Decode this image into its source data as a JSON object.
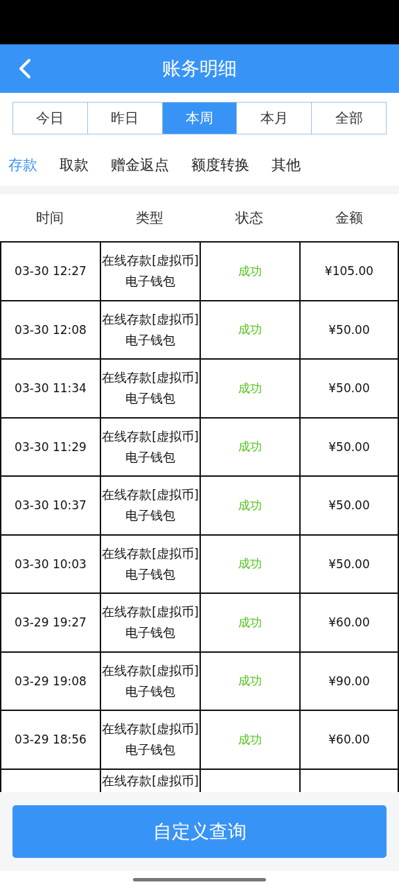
{
  "header": {
    "title": "账务明细"
  },
  "periods": [
    {
      "label": "今日",
      "selected": false
    },
    {
      "label": "昨日",
      "selected": false
    },
    {
      "label": "本周",
      "selected": true
    },
    {
      "label": "本月",
      "selected": false
    },
    {
      "label": "全部",
      "selected": false
    }
  ],
  "categories": [
    {
      "label": "存款",
      "selected": true
    },
    {
      "label": "取款",
      "selected": false
    },
    {
      "label": "赠金返点",
      "selected": false
    },
    {
      "label": "额度转换",
      "selected": false
    },
    {
      "label": "其他",
      "selected": false
    }
  ],
  "table": {
    "columns": [
      "时间",
      "类型",
      "状态",
      "金额"
    ],
    "rows": [
      {
        "time": "03-30 12:27",
        "type": [
          "在线存款[虚拟币]",
          "电子钱包"
        ],
        "status": "成功",
        "amount": "¥105.00"
      },
      {
        "time": "03-30 12:08",
        "type": [
          "在线存款[虚拟币]",
          "电子钱包"
        ],
        "status": "成功",
        "amount": "¥50.00"
      },
      {
        "time": "03-30 11:34",
        "type": [
          "在线存款[虚拟币]",
          "电子钱包"
        ],
        "status": "成功",
        "amount": "¥50.00"
      },
      {
        "time": "03-30 11:29",
        "type": [
          "在线存款[虚拟币]",
          "电子钱包"
        ],
        "status": "成功",
        "amount": "¥50.00"
      },
      {
        "time": "03-30 10:37",
        "type": [
          "在线存款[虚拟币]",
          "电子钱包"
        ],
        "status": "成功",
        "amount": "¥50.00"
      },
      {
        "time": "03-30 10:03",
        "type": [
          "在线存款[虚拟币]",
          "电子钱包"
        ],
        "status": "成功",
        "amount": "¥50.00"
      },
      {
        "time": "03-29 19:27",
        "type": [
          "在线存款[虚拟币]",
          "电子钱包"
        ],
        "status": "成功",
        "amount": "¥60.00"
      },
      {
        "time": "03-29 19:08",
        "type": [
          "在线存款[虚拟币]",
          "电子钱包"
        ],
        "status": "成功",
        "amount": "¥90.00"
      },
      {
        "time": "03-29 18:56",
        "type": [
          "在线存款[虚拟币]",
          "电子钱包"
        ],
        "status": "成功",
        "amount": "¥60.00"
      },
      {
        "type": [
          "在线存款[虚拟币]"
        ]
      }
    ]
  },
  "query_button": "自定义查询"
}
